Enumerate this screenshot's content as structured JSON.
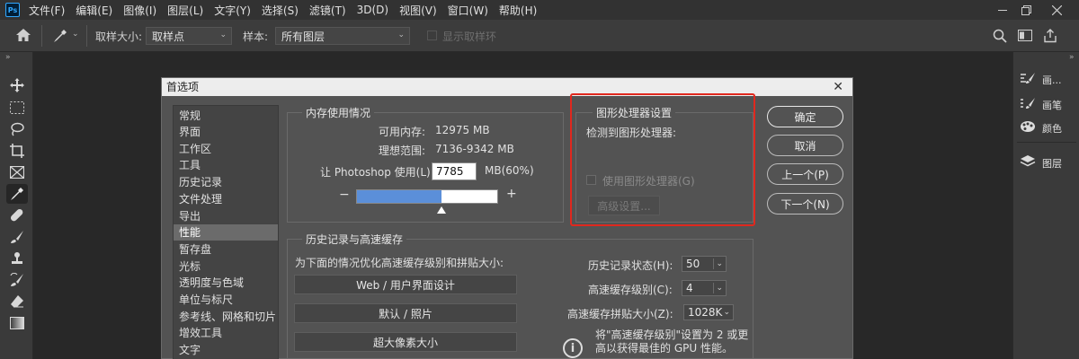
{
  "app_logo": "Ps",
  "menu": [
    "文件(F)",
    "编辑(E)",
    "图像(I)",
    "图层(L)",
    "文字(Y)",
    "选择(S)",
    "滤镜(T)",
    "3D(D)",
    "视图(V)",
    "窗口(W)",
    "帮助(H)"
  ],
  "options_bar": {
    "sample_size_label": "取样大小:",
    "sample_size_value": "取样点",
    "sample_label": "样本:",
    "sample_value": "所有图层",
    "show_ring_label": "显示取样环"
  },
  "right_panel": {
    "items": [
      "画...",
      "画笔",
      "颜色",
      "图层"
    ]
  },
  "dialog": {
    "title": "首选项",
    "categories": [
      "常规",
      "界面",
      "工作区",
      "工具",
      "历史记录",
      "文件处理",
      "导出",
      "性能",
      "暂存盘",
      "光标",
      "透明度与色域",
      "单位与标尺",
      "参考线、网格和切片",
      "增效工具",
      "文字"
    ],
    "selected_category": "性能",
    "memory": {
      "title": "内存使用情况",
      "available_label": "可用内存:",
      "available_value": "12975 MB",
      "ideal_label": "理想范围:",
      "ideal_value": "7136-9342 MB",
      "let_label": "让 Photoshop 使用(L):",
      "let_value": "7785",
      "let_unit": "MB(60%)",
      "minus": "−",
      "plus": "+",
      "usage_fraction": 0.6
    },
    "gpu": {
      "title": "图形处理器设置",
      "detected_label": "检测到图形处理器:",
      "use_gpu_label": "使用图形处理器(G)",
      "advanced_label": "高级设置..."
    },
    "history": {
      "title": "历史记录与高速缓存",
      "optimize_label": "为下面的情况优化高速缓存级别和拼贴大小:",
      "btn_web": "Web / 用户界面设计",
      "btn_default": "默认 / 照片",
      "btn_huge": "超大像素大小",
      "history_states_label": "历史记录状态(H):",
      "history_states_value": "50",
      "cache_levels_label": "高速缓存级别(C):",
      "cache_levels_value": "4",
      "tile_size_label": "高速缓存拼贴大小(Z):",
      "tile_size_value": "1028K",
      "note_line1": "将\"高速缓存级别\"设置为 2 或更",
      "note_line2": "高以获得最佳的 GPU 性能。"
    },
    "buttons": {
      "ok": "确定",
      "cancel": "取消",
      "prev": "上一个(P)",
      "next": "下一个(N)"
    }
  }
}
